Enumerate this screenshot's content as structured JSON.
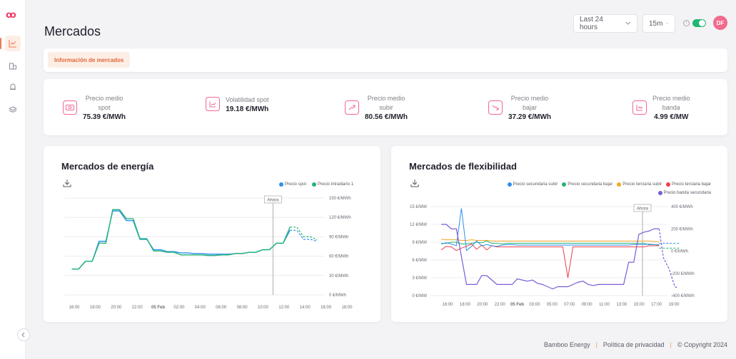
{
  "app": {
    "logo": "oo"
  },
  "sidebar": {
    "items": [
      {
        "name": "chart-icon",
        "active": true
      },
      {
        "name": "building-icon",
        "active": false
      },
      {
        "name": "alarm-icon",
        "active": false
      },
      {
        "name": "layers-icon",
        "active": false
      }
    ]
  },
  "header": {
    "title": "Mercados",
    "range_label": "Last 24 hours",
    "interval_label": "15m",
    "avatar_initials": "DF",
    "toggle_on": true
  },
  "tabs": [
    {
      "label": "Información de mercados",
      "active": true
    }
  ],
  "kpis": [
    {
      "label_lines": [
        "Precio medio",
        "spot"
      ],
      "value": "75.39 €/MWh",
      "icon": "money-icon"
    },
    {
      "label_lines": [
        "Volatilidad spot"
      ],
      "value": "19.18 €/MWh",
      "icon": "volatility-chart-icon"
    },
    {
      "label_lines": [
        "Precio medio",
        "subir"
      ],
      "value": "80.56 €/MWh",
      "icon": "trend-up-icon"
    },
    {
      "label_lines": [
        "Precio medio",
        "bajar"
      ],
      "value": "37.29 €/MWh",
      "icon": "trend-down-icon"
    },
    {
      "label_lines": [
        "Precio medio",
        "banda"
      ],
      "value": "4.99 €/MW",
      "icon": "band-chart-icon"
    }
  ],
  "chart_data": [
    {
      "type": "line",
      "title": "Mercados de energía",
      "now_label": "Ahora",
      "now_x": 14.75,
      "ylim": [
        0,
        150
      ],
      "yticks": [
        0,
        30,
        60,
        90,
        120,
        150
      ],
      "ytick_labels": [
        "0 €/MWh",
        "30 €/MWh",
        "60 €/MWh",
        "90 €/MWh",
        "120 €/MWh",
        "150 €/MWh"
      ],
      "xlim": [
        -0.5,
        18.5
      ],
      "xticks": [
        0,
        2,
        4,
        6,
        8,
        10,
        12,
        14,
        16,
        18,
        20,
        22,
        24
      ],
      "xtick_labels": [
        "16:00",
        "18:00",
        "20:00",
        "22:00",
        "05 Feb",
        "02:00",
        "04:00",
        "06:00",
        "08:00",
        "10:00",
        "12:00",
        "14:00",
        "16:00",
        "18:00"
      ],
      "series": [
        {
          "name": "Precio spot",
          "color": "#2f8ff0",
          "x": [
            0,
            0.5,
            1,
            1.5,
            2,
            2.5,
            3,
            3.5,
            4,
            4.5,
            5,
            5.5,
            6,
            6.5,
            7,
            7.5,
            8,
            8.5,
            9,
            9.5,
            10,
            10.5,
            11,
            11.5,
            12,
            12.5,
            13,
            13.5,
            14,
            14.5,
            15,
            15.5,
            16,
            16.5,
            17,
            17.5,
            18
          ],
          "y": [
            40,
            40,
            52,
            52,
            83,
            83,
            130,
            130,
            115,
            115,
            86,
            86,
            70,
            70,
            67,
            67,
            65,
            65,
            64,
            64,
            63,
            63,
            63,
            63,
            64,
            64,
            66,
            66,
            70,
            70,
            80,
            80,
            100,
            100,
            86,
            86,
            83
          ],
          "forecast_from_x": 16
        },
        {
          "name": "Precio intradiario 1",
          "color": "#22b573",
          "x": [
            0,
            0.5,
            1,
            1.5,
            2,
            2.5,
            3,
            3.5,
            4,
            4.5,
            5,
            5.5,
            6,
            6.5,
            7,
            7.5,
            8,
            8.5,
            9,
            9.5,
            10,
            10.5,
            11,
            11.5,
            12,
            12.5,
            13,
            13.5,
            14,
            14.5,
            15,
            15.5,
            16,
            16.5,
            17,
            17.5,
            18
          ],
          "y": [
            40,
            40,
            52,
            52,
            80,
            80,
            132,
            132,
            118,
            118,
            87,
            87,
            68,
            68,
            66,
            66,
            62,
            62,
            62,
            62,
            61,
            61,
            62,
            62,
            64,
            64,
            66,
            66,
            70,
            70,
            80,
            80,
            105,
            105,
            90,
            90,
            85
          ],
          "forecast_from_x": 16
        }
      ]
    },
    {
      "type": "line",
      "title": "Mercados de flexibilidad",
      "now_label": "Ahora",
      "ylim_left": [
        0,
        15
      ],
      "ytick_labels_left": [
        "0 €/MW",
        "3 €/MW",
        "6 €/MW",
        "9 €/MW",
        "12 €/MW",
        "15 €/MW"
      ],
      "ylim_right": [
        -400,
        400
      ],
      "ytick_labels_right": [
        "-400 €/MWh",
        "-200 €/MWh",
        "0 €/MWh",
        "200 €/MWh",
        "400 €/MWh"
      ],
      "xtick_labels": [
        "16:00",
        "18:00",
        "20:00",
        "22:00",
        "05 Feb",
        "03:00",
        "05:00",
        "07:00",
        "09:00",
        "11:00",
        "13:00",
        "15:00",
        "17:00",
        "19:00"
      ],
      "series": [
        {
          "name": "Precio secundaria subir",
          "color": "#2f8ff0"
        },
        {
          "name": "Precio secundaria bajar",
          "color": "#22b573"
        },
        {
          "name": "Precio terciaria subir",
          "color": "#f5a623"
        },
        {
          "name": "Precio terciaria bajar",
          "color": "#ef3e4d"
        },
        {
          "name": "Precio banda secundaria",
          "color": "#7b5cd6"
        }
      ]
    }
  ],
  "footer": {
    "company": "Bamboo Energy",
    "privacy": "Política de privacidad",
    "copyright": "© Copyright 2024"
  }
}
